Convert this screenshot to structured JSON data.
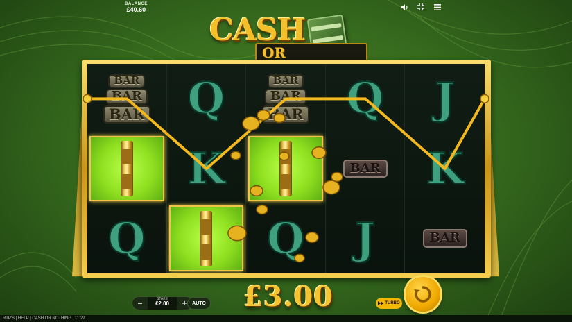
{
  "hud": {
    "balance_label": "BALANCE",
    "balance_value": "£40.60",
    "icons": [
      "volume-icon",
      "fullscreen-icon",
      "menu-icon"
    ]
  },
  "logo": {
    "line1": "CASH",
    "line2": "OR NOTHING"
  },
  "reels": [
    [
      {
        "type": "bar3",
        "labels": [
          "BAR",
          "BAR",
          "BAR"
        ]
      },
      {
        "type": "cash"
      },
      {
        "type": "letter",
        "value": "Q"
      }
    ],
    [
      {
        "type": "letter",
        "value": "Q"
      },
      {
        "type": "letter",
        "value": "K"
      },
      {
        "type": "cash"
      }
    ],
    [
      {
        "type": "bar3",
        "labels": [
          "BAR",
          "BAR",
          "BAR"
        ]
      },
      {
        "type": "cash"
      },
      {
        "type": "letter",
        "value": "Q"
      }
    ],
    [
      {
        "type": "letter",
        "value": "Q"
      },
      {
        "type": "bar",
        "value": "BAR"
      },
      {
        "type": "letter",
        "value": "J"
      }
    ],
    [
      {
        "type": "letter",
        "value": "J"
      },
      {
        "type": "letter",
        "value": "K"
      },
      {
        "type": "bar",
        "value": "BAR"
      }
    ]
  ],
  "winline": {
    "row_path": [
      1,
      1,
      2,
      1,
      1,
      2,
      1
    ],
    "color": "#f2b81d"
  },
  "controls": {
    "win_amount": "£3.00",
    "minus": "−",
    "plus": "+",
    "stake_label": "STAKE",
    "stake_value": "£2.00",
    "auto_label": "AUTO",
    "turbo_label": "TURBO"
  },
  "footer": {
    "text": "RTP'S | HELP | CASH OR NOTHING | 11:22"
  },
  "colors": {
    "gold": "#f4c530",
    "cash_green": "#8fe020",
    "bg_green": "#3f7a22"
  }
}
